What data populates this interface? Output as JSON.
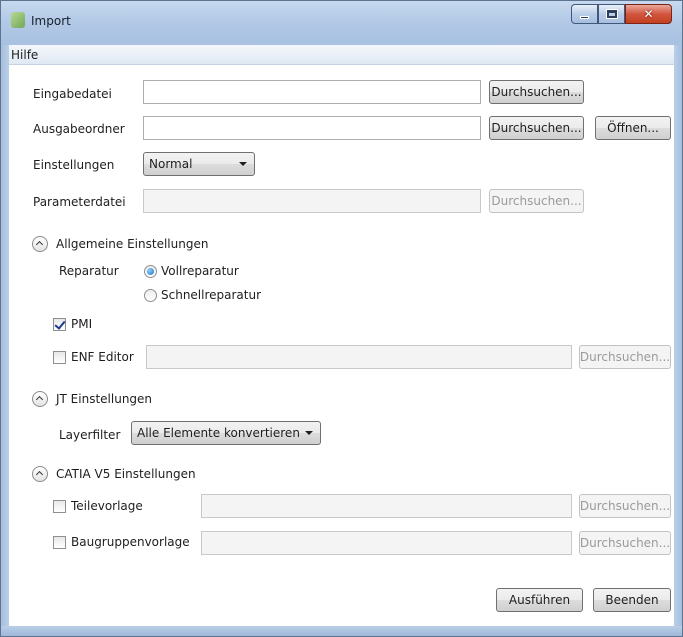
{
  "window": {
    "title": "Import",
    "icons": {
      "app": "app-icon",
      "minimize": "minimize-icon",
      "maximize": "maximize-icon",
      "close": "close-icon",
      "close_glyph": "✕"
    }
  },
  "menu": {
    "items": [
      {
        "label": "Hilfe"
      }
    ]
  },
  "files": {
    "input_label": "Eingabedatei",
    "input_value": "",
    "output_label": "Ausgabeordner",
    "output_value": "",
    "settings_label": "Einstellungen",
    "settings_value": "Normal",
    "param_label": "Parameterdatei",
    "param_value": "",
    "browse_label": "Durchsuchen...",
    "open_label": "Öffnen..."
  },
  "general": {
    "header": "Allgemeine Einstellungen",
    "repair_label": "Reparatur",
    "repair_options": [
      {
        "label": "Vollreparatur",
        "checked": true
      },
      {
        "label": "Schnellreparatur",
        "checked": false
      }
    ],
    "pmi_label": "PMI",
    "pmi_checked": true,
    "enf_label": "ENF Editor",
    "enf_checked": false,
    "enf_value": ""
  },
  "jt": {
    "header": "JT Einstellungen",
    "layer_label": "Layerfilter",
    "layer_value": "Alle Elemente konvertieren"
  },
  "catia": {
    "header": "CATIA V5 Einstellungen",
    "part_label": "Teilevorlage",
    "part_checked": false,
    "part_value": "",
    "assembly_label": "Baugruppenvorlage",
    "assembly_checked": false,
    "assembly_value": ""
  },
  "footer": {
    "run_label": "Ausführen",
    "quit_label": "Beenden"
  },
  "colors": {
    "accent": "#1d6fc4",
    "title_gradient": "#b3c9e6",
    "close": "#c3401f"
  }
}
